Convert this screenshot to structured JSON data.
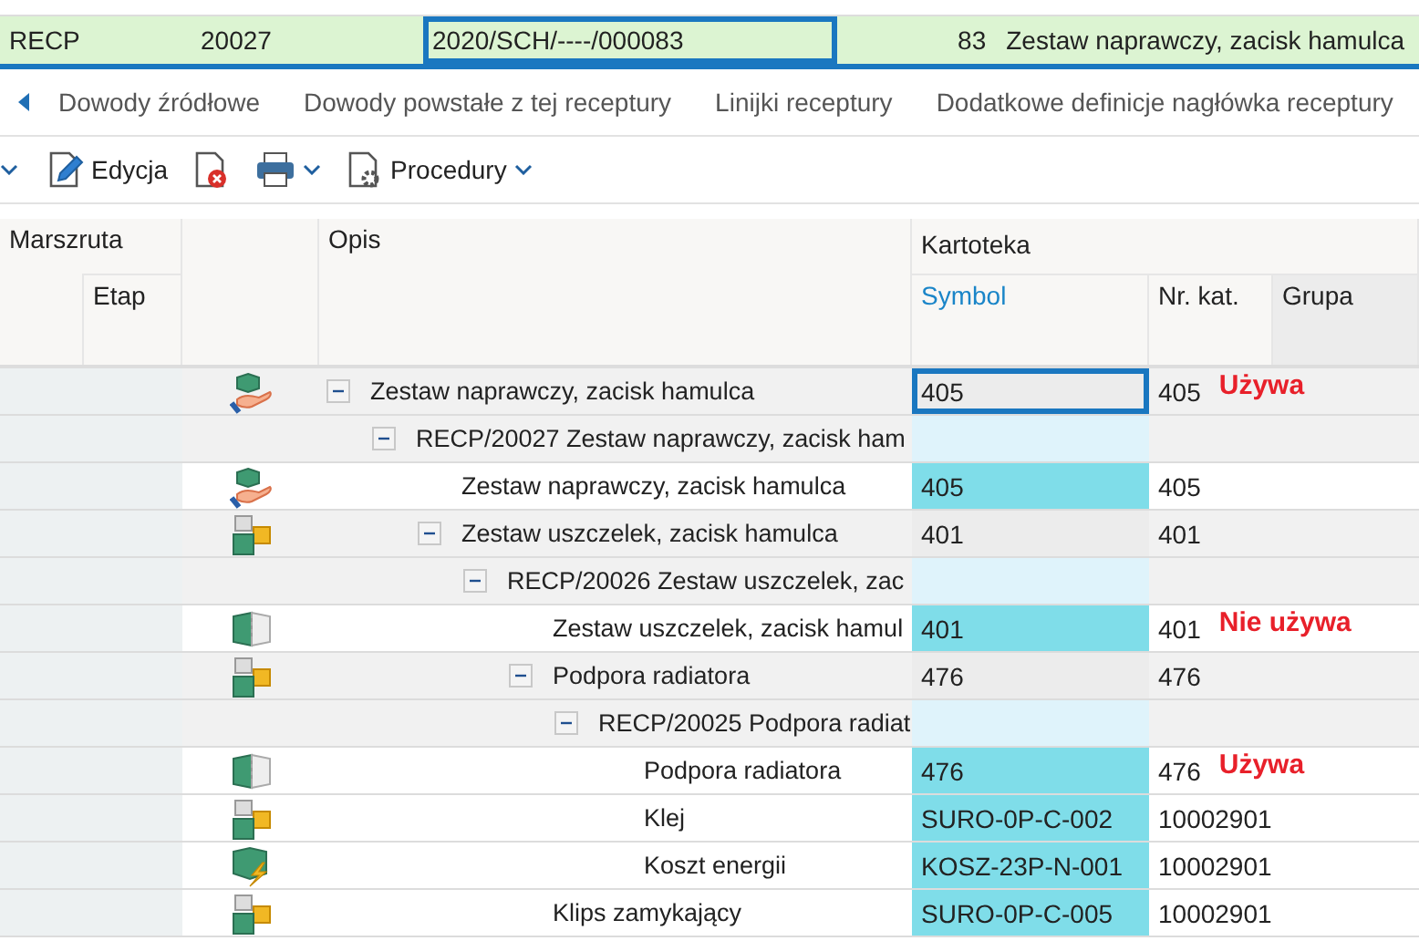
{
  "record": {
    "cells": [
      {
        "text": "RECP",
        "selected": false
      },
      {
        "text": "20027",
        "selected": false
      },
      {
        "text": "2020/SCH/----/000083",
        "selected": true
      },
      {
        "text": "83",
        "selected": false
      },
      {
        "text": "Zestaw naprawczy, zacisk hamulca",
        "selected": false
      }
    ]
  },
  "tabs": [
    {
      "label": "Dowody źródłowe"
    },
    {
      "label": "Dowody powstałe z tej receptury"
    },
    {
      "label": "Linijki receptury"
    },
    {
      "label": "Dodatkowe definicje nagłówka receptury"
    }
  ],
  "toolbar": [
    {
      "kind": "caret"
    },
    {
      "kind": "edit",
      "label": "Edycja"
    },
    {
      "kind": "delete"
    },
    {
      "kind": "print"
    },
    {
      "kind": "procedures",
      "label": "Procedury"
    }
  ],
  "table": {
    "header": {
      "marszruta": "Marszruta",
      "etap": "Etap",
      "opis": "Opis",
      "kartoteka": "Kartoteka",
      "symbol": "Symbol",
      "nr_kat": "Nr. kat.",
      "grupa": "Grupa"
    },
    "rows": [
      {
        "kind": "kit",
        "description": "Zestaw naprawczy, zacisk hamulca",
        "symbol": "405",
        "nr_kat": "405",
        "note": "Używa",
        "selected": true,
        "expanded": true,
        "children": [
          {
            "kind": "recipe",
            "description": "RECP/20027 Zestaw naprawczy, zacisk ham",
            "selected": false,
            "expanded": true,
            "children": [
              {
                "kind": "kit",
                "description": "Zestaw naprawczy, zacisk hamulca",
                "symbol": "405",
                "nr_kat": "405",
                "selected": false
              },
              {
                "kind": "assembly",
                "description": "Zestaw uszczelek, zacisk hamulca",
                "symbol": "401",
                "nr_kat": "401",
                "selected": false,
                "expanded": true,
                "children": [
                  {
                    "kind": "recipe",
                    "description": "RECP/20026 Zestaw uszczelek, zac",
                    "selected": false,
                    "expanded": true,
                    "children": [
                      {
                        "kind": "component",
                        "description": "Zestaw uszczelek, zacisk hamul",
                        "symbol": "401",
                        "nr_kat": "401",
                        "note": "Nie używa",
                        "selected": false
                      },
                      {
                        "kind": "assembly",
                        "description": "Podpora radiatora",
                        "symbol": "476",
                        "nr_kat": "476",
                        "selected": false,
                        "expanded": true,
                        "children": [
                          {
                            "kind": "recipe",
                            "description": "RECP/20025 Podpora radiat",
                            "selected": false,
                            "expanded": true,
                            "children": [
                              {
                                "kind": "component",
                                "description": "Podpora radiatora",
                                "symbol": "476",
                                "nr_kat": "476",
                                "note": "Używa",
                                "selected": false
                              },
                              {
                                "kind": "assembly",
                                "description": "Klej",
                                "symbol": "SURO-0P-C-002",
                                "nr_kat": "10002901",
                                "selected": false
                              },
                              {
                                "kind": "cost",
                                "description": "Koszt energii",
                                "symbol": "KOSZ-23P-N-001",
                                "nr_kat": "10002901",
                                "selected": false
                              }
                            ]
                          }
                        ]
                      },
                      {
                        "kind": "assembly",
                        "description": "Klips zamykający",
                        "symbol": "SURO-0P-C-005",
                        "nr_kat": "10002901",
                        "selected": false
                      }
                    ]
                  }
                ]
              }
            ]
          }
        ]
      }
    ]
  }
}
